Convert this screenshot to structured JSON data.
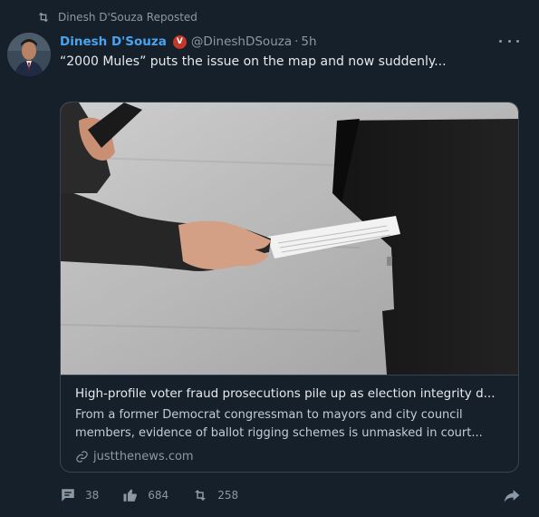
{
  "repost": {
    "label": "Dinesh D'Souza Reposted"
  },
  "author": {
    "name": "Dinesh D'Souza",
    "badge": "V",
    "handle": "@DineshDSouza",
    "separator": "·",
    "time": "5h"
  },
  "tweet": {
    "text": "“2000 Mules” puts the issue on the map and now suddenly..."
  },
  "card": {
    "title": "High-profile voter fraud prosecutions pile up as election integrity d...",
    "description": "From a former Democrat congressman to mayors and city council members, evidence of ballot rigging schemes is unmasked in court...",
    "domain": "justthenews.com"
  },
  "actions": {
    "replies": "38",
    "likes": "684",
    "reposts": "258"
  },
  "colors": {
    "background": "#15202b",
    "name": "#4aa3f0",
    "muted": "#8b98a5",
    "badge": "#c0392b"
  },
  "icons": [
    "repost-icon",
    "verified-badge-icon",
    "more-icon",
    "link-icon",
    "reply-icon",
    "like-icon",
    "share-icon"
  ]
}
